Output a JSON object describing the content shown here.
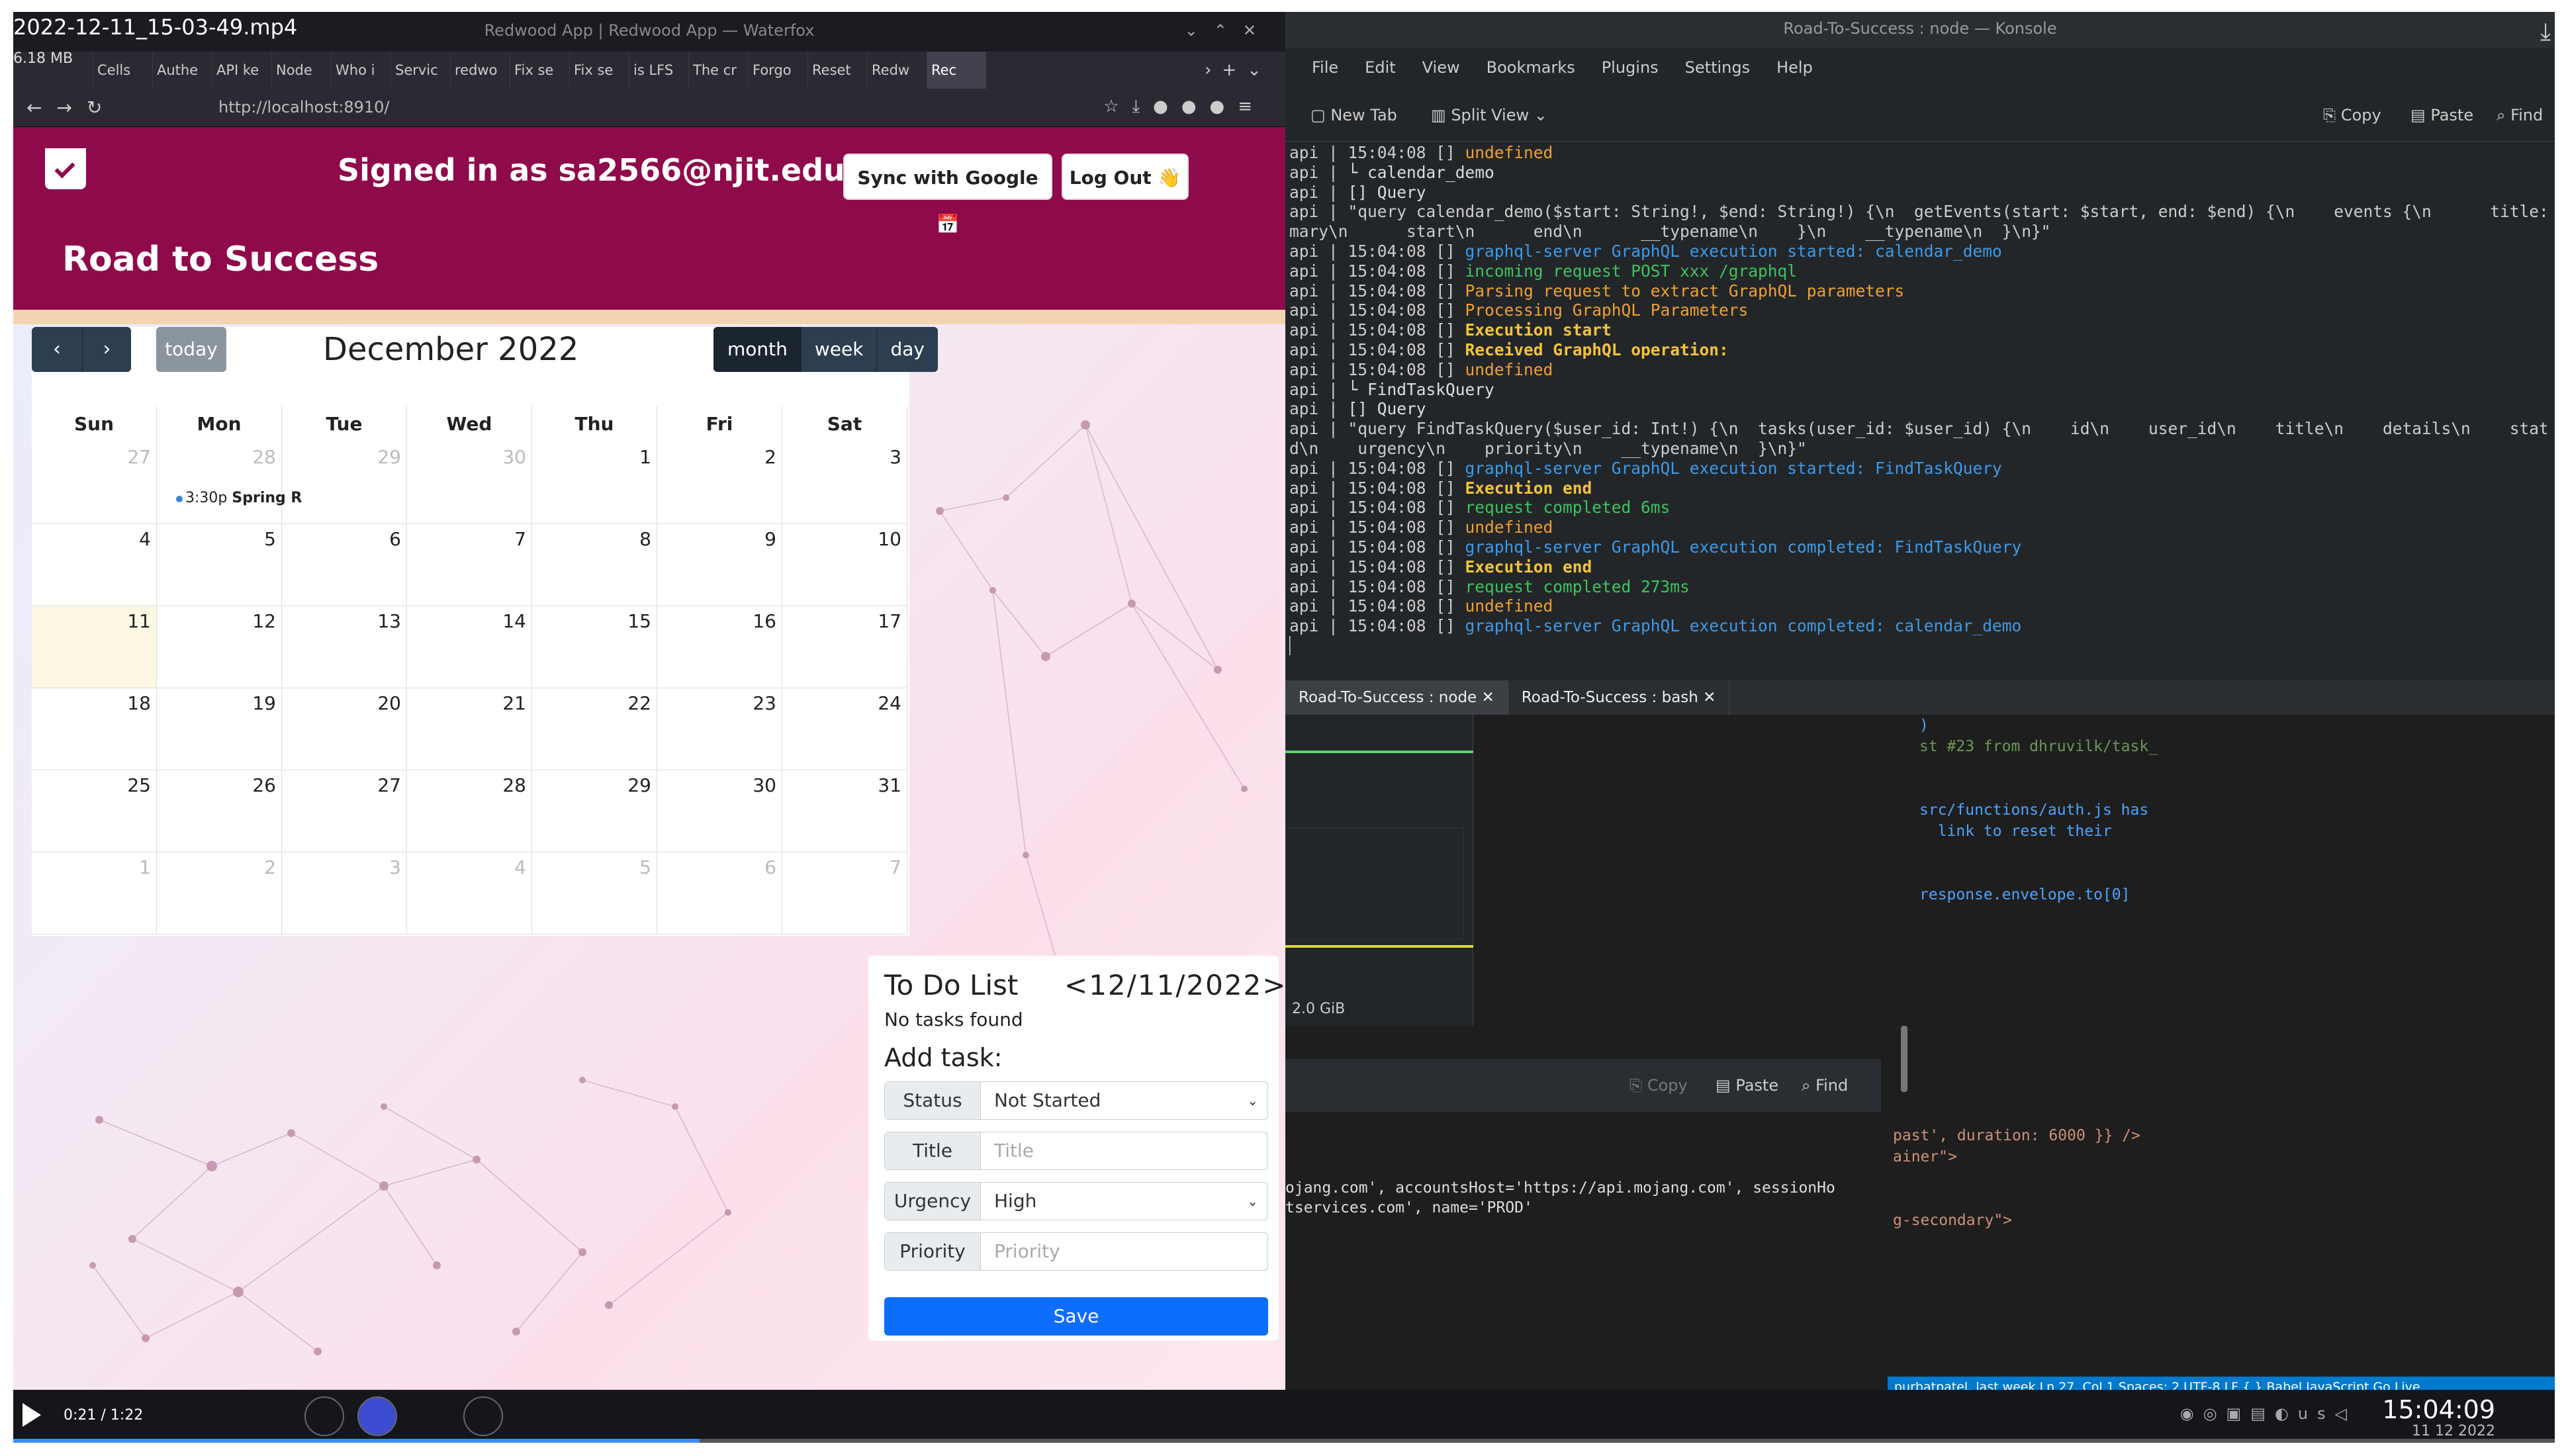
{
  "video": {
    "title": "2022-12-11_15-03-49.mp4",
    "size": "6.18 MB",
    "time": "0:21 / 1:22",
    "progress_fraction": 0.27,
    "clock": "15:04:09",
    "date": "11 12 2022"
  },
  "browser": {
    "window_title": "Redwood App | Redwood App — Waterfox",
    "tabs": [
      "Cells",
      "Authe",
      "API ke",
      "Node",
      "Who i",
      "Servic",
      "redwo",
      "Fix se",
      "Fix se",
      "is LFS",
      "The cr",
      "Forgo",
      "Reset",
      "Redw",
      "Rec"
    ],
    "url": "http://localhost:8910/"
  },
  "app": {
    "signed_in": "Signed in as sa2566@njit.edu",
    "sync_label": "Sync with Google 📅",
    "logout_label": "Log Out 👋",
    "brand": "Road to Success"
  },
  "calendar": {
    "today_label": "today",
    "title": "December 2022",
    "views": [
      "month",
      "week",
      "day"
    ],
    "days_of_week": [
      "Sun",
      "Mon",
      "Tue",
      "Wed",
      "Thu",
      "Fri",
      "Sat"
    ],
    "weeks": [
      [
        "27",
        "28",
        "29",
        "30",
        "1",
        "2",
        "3"
      ],
      [
        "4",
        "5",
        "6",
        "7",
        "8",
        "9",
        "10"
      ],
      [
        "11",
        "12",
        "13",
        "14",
        "15",
        "16",
        "17"
      ],
      [
        "18",
        "19",
        "20",
        "21",
        "22",
        "23",
        "24"
      ],
      [
        "25",
        "26",
        "27",
        "28",
        "29",
        "30",
        "31"
      ],
      [
        "1",
        "2",
        "3",
        "4",
        "5",
        "6",
        "7"
      ]
    ],
    "event_time": "3:30p",
    "event_title": "Spring R"
  },
  "todo": {
    "title": "To Do List",
    "date": "<12/11/2022",
    "next": ">",
    "empty": "No tasks found",
    "add_label": "Add task:",
    "status_label": "Status",
    "status_value": "Not Started",
    "title_label": "Title",
    "title_placeholder": "Title",
    "urgency_label": "Urgency",
    "urgency_value": "High",
    "priority_label": "Priority",
    "priority_placeholder": "Priority",
    "save_label": "Save"
  },
  "konsole": {
    "window_title": "Road-To-Success : node — Konsole",
    "menu": [
      "File",
      "Edit",
      "View",
      "Bookmarks",
      "Plugins",
      "Settings",
      "Help"
    ],
    "new_tab": "New Tab",
    "split_view": "Split View",
    "copy": "Copy",
    "paste": "Paste",
    "find": "Find",
    "tabs": [
      "Road-To-Success : node",
      "Road-To-Success : bash"
    ],
    "lines": [
      [
        "api | 15:04:08 [] ",
        "undefined",
        "ye"
      ],
      [
        "api | ",
        "└ calendar_demo",
        "wh"
      ],
      [
        "api | ",
        "[] Query",
        "wh"
      ],
      [
        "api | \"query calendar_demo($start: String!, $end: String!) {\\n  getEvents(start: $start, end: $end) {\\n    events {\\n      title: sum",
        "",
        "wh"
      ],
      [
        "mary\\n      start\\n      end\\n      __typename\\n    }\\n    __typename\\n  }\\n}\"",
        "",
        "wh"
      ],
      [
        "api | 15:04:08 [] ",
        "graphql-server GraphQL execution started: calendar_demo",
        "bl"
      ],
      [
        "api | 15:04:08 [] ",
        "incoming request POST xxx /graphql",
        "gr"
      ],
      [
        "api | 15:04:08 [] ",
        "Parsing request to extract GraphQL parameters",
        "ye"
      ],
      [
        "api | 15:04:08 [] ",
        "Processing GraphQL Parameters",
        "ye"
      ],
      [
        "api | 15:04:08 [] ",
        "Execution start",
        "yb"
      ],
      [
        "api | 15:04:08 [] ",
        "Received GraphQL operation:",
        "yb"
      ],
      [
        "api | 15:04:08 [] ",
        "undefined",
        "ye"
      ],
      [
        "api | ",
        "└ FindTaskQuery",
        "wh"
      ],
      [
        "api | ",
        "[] Query",
        "wh"
      ],
      [
        "api | \"query FindTaskQuery($user_id: Int!) {\\n  tasks(user_id: $user_id) {\\n    id\\n    user_id\\n    title\\n    details\\n    status_i",
        "",
        "wh"
      ],
      [
        "d\\n    urgency\\n    priority\\n    __typename\\n  }\\n}\"",
        "",
        "wh"
      ],
      [
        "api | 15:04:08 [] ",
        "graphql-server GraphQL execution started: FindTaskQuery",
        "bl"
      ],
      [
        "api | 15:04:08 [] ",
        "Execution end",
        "yb"
      ],
      [
        "api | 15:04:08 [] ",
        "request completed 6ms",
        "gr"
      ],
      [
        "api | 15:04:08 [] ",
        "undefined",
        "ye"
      ],
      [
        "api | 15:04:08 [] ",
        "graphql-server GraphQL execution completed: FindTaskQuery",
        "bl"
      ],
      [
        "api | 15:04:08 [] ",
        "Execution end",
        "yb"
      ],
      [
        "api | 15:04:08 [] ",
        "request completed 273ms",
        "gr"
      ],
      [
        "api | 15:04:08 [] ",
        "undefined",
        "ye"
      ],
      [
        "api | 15:04:08 [] ",
        "graphql-server GraphQL execution completed: calendar_demo",
        "bl"
      ]
    ]
  },
  "lower": {
    "memory": "2.0 GiB",
    "code1": [
      ")",
      "st #23 from dhruvilk/task_",
      "",
      "",
      "src/functions/auth.js has",
      "  link to reset their",
      "",
      "",
      "response.envelope.to[0]"
    ],
    "k2_copy": "Copy",
    "k2_paste": "Paste",
    "k2_find": "Find",
    "k2_text": [
      "ojang.com', accountsHost='https://api.mojang.com', sessionHo",
      "tservices.com', name='PROD'"
    ],
    "code2": [
      "past', duration: 6000 }} />",
      "ainer\">",
      "",
      "",
      "g-secondary\">"
    ],
    "status": "purbatpatel, last week   Ln 27, Col 1   Spaces: 2   UTF-8   LF   { } Babel JavaScript   Go Live"
  }
}
